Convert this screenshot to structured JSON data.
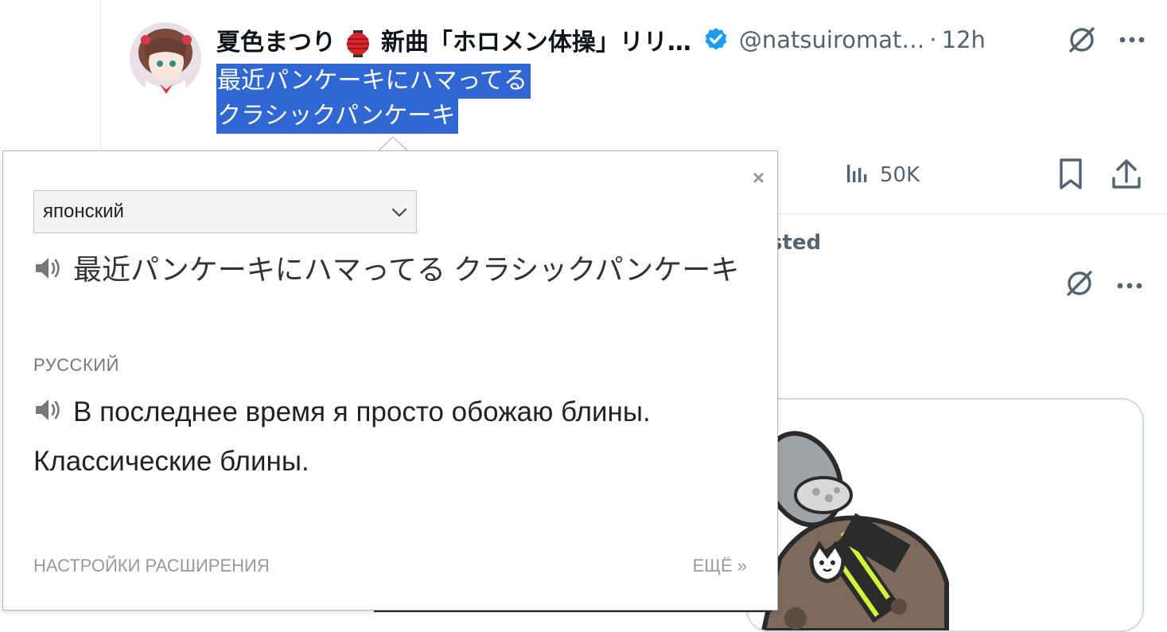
{
  "tweet": {
    "author_name_part1": "夏色まつり",
    "author_name_part2": "新曲「ホロメン体操」リリ…",
    "handle": "@natsuiromat…",
    "separator": "·",
    "time": "12h",
    "text_line1": "最近パンケーキにハマってる",
    "text_line2": "クラシックパンケーキ",
    "views_count": "50K"
  },
  "feed": {
    "suggested_fragment": "sted"
  },
  "popup": {
    "source_language": "японский",
    "source_text": "最近パンケーキにハマってる クラシックパンケーキ",
    "target_language_label": "РУССКИЙ",
    "translation": "В последнее время я просто обожаю блины. Классические блины.",
    "settings_link": "НАСТРОЙКИ РАСШИРЕНИЯ",
    "more_link": "ЕЩЁ »",
    "close_symbol": "×"
  },
  "colors": {
    "selection": "#3167d3",
    "verified": "#1d9bf0",
    "secondary_text": "#536471"
  },
  "icons": [
    "lantern-emoji-icon",
    "verified-badge-icon",
    "grok-icon",
    "more-icon",
    "views-chart-icon",
    "bookmark-icon",
    "share-icon",
    "speaker-icon",
    "chevron-down-icon",
    "close-icon"
  ]
}
